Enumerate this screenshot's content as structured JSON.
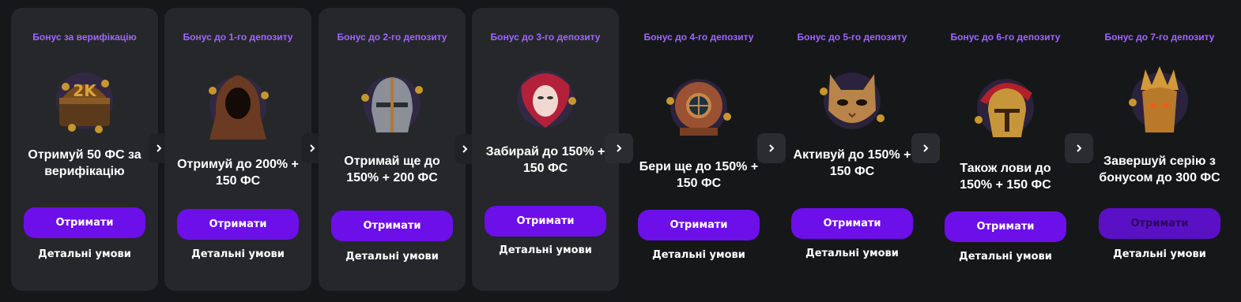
{
  "colors": {
    "page_bg": "#161719",
    "card_bg": "#25272a",
    "accent": "#6c0fe8",
    "tag": "#a066ff"
  },
  "cards": [
    {
      "tag": "Бонус за верифікацію",
      "line1": "Отримуй 50 ФС за",
      "line2": "верифікацію",
      "button": "Отримати",
      "terms": "Детальні умови",
      "art": "treasure-chest-icon"
    },
    {
      "tag": "Бонус до 1-го депозиту",
      "line1": "Отримуй до 200% +",
      "line2": "150 ФС",
      "button": "Отримати",
      "terms": "Детальні умови",
      "art": "hooded-cloak-icon"
    },
    {
      "tag": "Бонус до 2-го депозиту",
      "line1": "Отримай ще до",
      "line2": "150% + 200 ФС",
      "button": "Отримати",
      "terms": "Детальні умови",
      "art": "knight-helmet-icon"
    },
    {
      "tag": "Бонус до 3-го депозиту",
      "line1": "Забирай до 150% +",
      "line2": "150 ФС",
      "button": "Отримати",
      "terms": "Детальні умови",
      "art": "carnival-mask-icon"
    },
    {
      "tag": "Бонус до 4-го депозиту",
      "line1": "Бери ще до 150% +",
      "line2": "150 ФС",
      "button": "Отримати",
      "terms": "Детальні умови",
      "art": "diving-helmet-icon"
    },
    {
      "tag": "Бонус до 5-го депозиту",
      "line1": "Активуй до 150% +",
      "line2": "150 ФС",
      "button": "Отримати",
      "terms": "Детальні умови",
      "art": "cat-mask-icon"
    },
    {
      "tag": "Бонус до 6-го депозиту",
      "line1": "Також лови до",
      "line2": "150% + 150 ФС",
      "button": "Отримати",
      "terms": "Детальні умови",
      "art": "spartan-helmet-icon"
    },
    {
      "tag": "Бонус до 7-го депозиту",
      "line1": "Завершуй серію з",
      "line2": "бонусом до 300 ФС",
      "button": "Отримати",
      "terms": "Детальні умови",
      "art": "golden-crown-helmet-icon"
    }
  ]
}
